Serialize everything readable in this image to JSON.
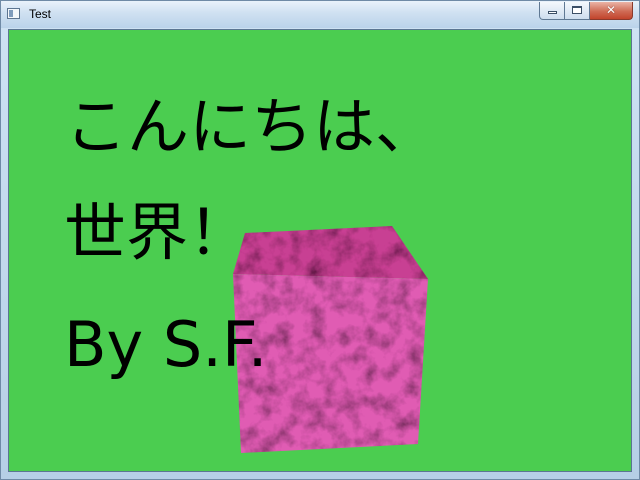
{
  "window": {
    "title": "Test",
    "controls": {
      "minimize_icon": "minimize-icon",
      "maximize_icon": "maximize-icon",
      "close_icon": "close-icon",
      "close_glyph": "✕"
    }
  },
  "canvas": {
    "background_color": "#4bcd50",
    "cube_color": "#d94fa8",
    "text_lines": [
      "こんにちは、",
      "世界！",
      "By S.F."
    ]
  }
}
